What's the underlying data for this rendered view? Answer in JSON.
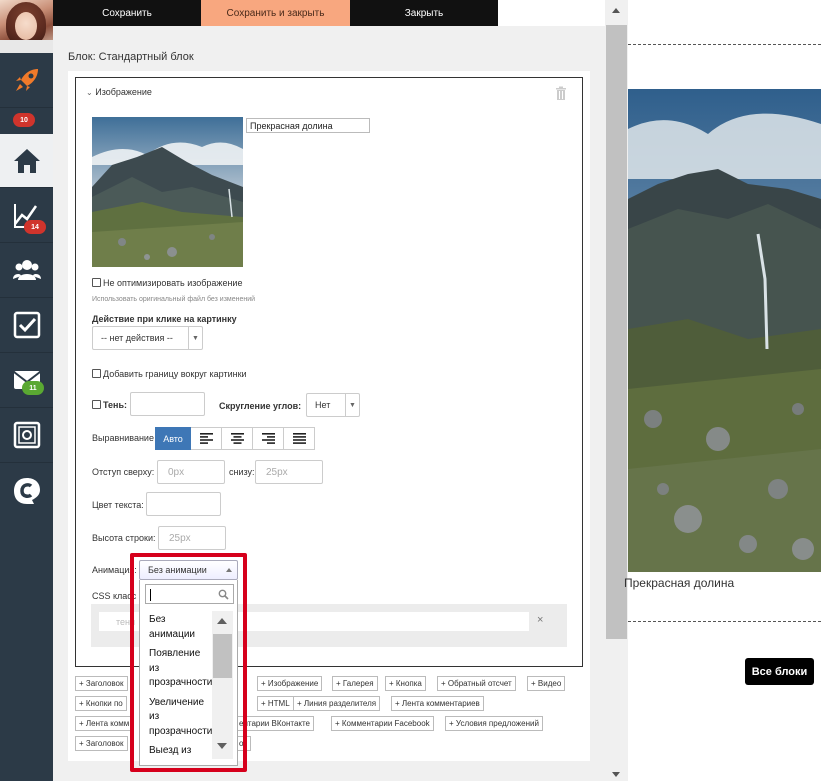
{
  "toolbar": {
    "save": "Сохранить",
    "save_close": "Сохранить и закрыть",
    "close": "Закрыть"
  },
  "sidebar": {
    "items": [
      {
        "icon": "rocket-icon"
      },
      {
        "badge": "10"
      },
      {
        "icon": "home-icon",
        "active": true
      },
      {
        "icon": "chart-icon",
        "badge": "14"
      },
      {
        "icon": "users-icon"
      },
      {
        "icon": "checkbox-icon"
      },
      {
        "icon": "mail-icon",
        "badge": "11"
      },
      {
        "icon": "safe-icon"
      },
      {
        "icon": "logo-c-icon"
      }
    ]
  },
  "editor": {
    "block_title": "Блок: Стандартный блок",
    "section_title": "Изображение",
    "alt_value": "Прекрасная долина",
    "no_optimize": "Не оптимизировать изображение",
    "no_optimize_hint": "Использовать оригинальный файл без изменений",
    "click_action_label": "Действие при клике на картинку",
    "click_action_value": "-- нет действия --",
    "border_label": "Добавить границу вокруг картинки",
    "shadow_label": "Тень:",
    "radius_label": "Скругление углов:",
    "radius_value": "Нет",
    "align_label": "Выравнивание",
    "align_auto": "Авто",
    "padding_top_label": "Отступ сверху:",
    "padding_top_placeholder": "0px",
    "padding_bottom_label": "снизу:",
    "padding_bottom_placeholder": "25px",
    "text_color_label": "Цвет текста:",
    "line_height_label": "Высота строки:",
    "line_height_placeholder": "25px",
    "animation_label": "Анимация:",
    "animation_value": "Без анимации",
    "css_label": "CSS класс",
    "css_placeholder": "тени",
    "css_clear": "×"
  },
  "dropdown": {
    "options": [
      "Без анимации",
      "Появление из прозрачности",
      "Увеличение из прозрачности",
      "Выезд из"
    ]
  },
  "tags": [
    "+ Заголовок",
    "кт",
    "+ Изображение",
    "+ Галерея",
    "+ Кнопка",
    "+ Обратный отсчет",
    "+ Видео",
    "+ Кнопки по",
    "+ HTML",
    "+ Линия разделителя",
    "+ Лента комментариев",
    "+ Лента комм",
    "ентарии ВКонтакте",
    "+ Комментарии Facebook",
    "+ Условия предложений",
    "+ Заголовок",
    "ок"
  ],
  "preview": {
    "caption": "Прекрасная долина",
    "all_blocks": "Все блоки"
  },
  "colors": {
    "sidebar": "#2c3a47",
    "accent_orange": "#f8a77f",
    "accent_blue": "#3e77b6",
    "highlight_red": "#d6001c"
  }
}
